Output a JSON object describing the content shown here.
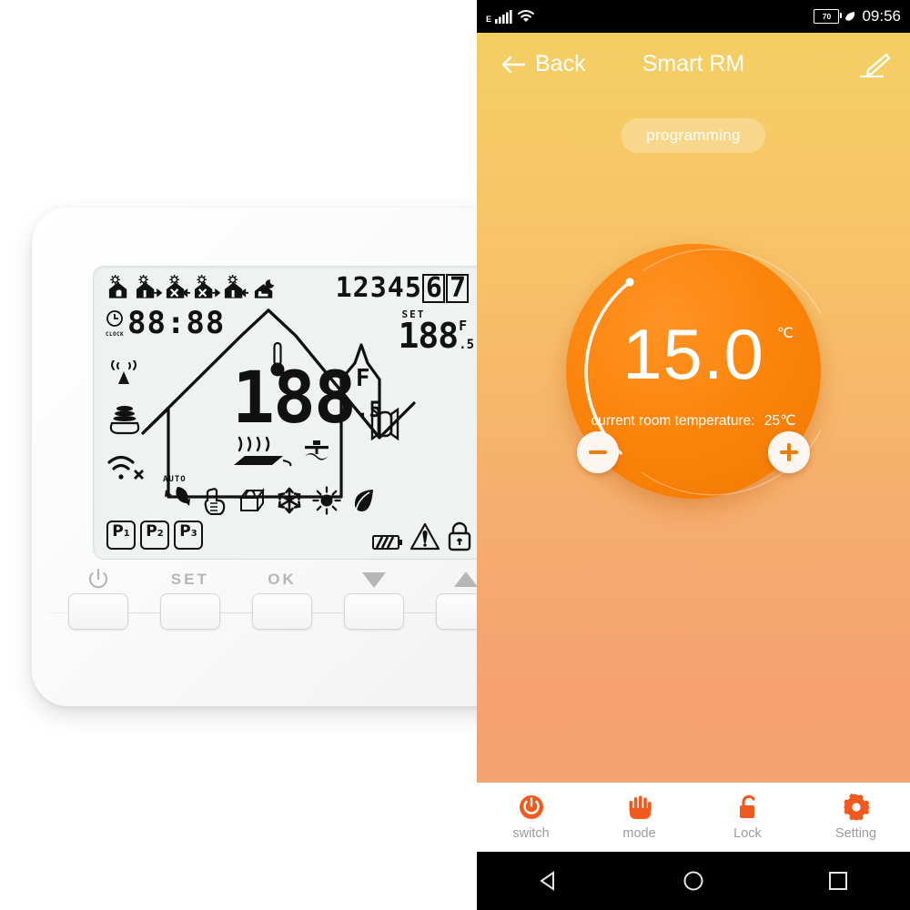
{
  "left_panel": {
    "device_name": "programmable-room-thermostat",
    "lcd": {
      "scene_icons": [
        "wake-home-icon",
        "leave-home-icon",
        "return-home-icon",
        "leave-home-2-icon",
        "return-home-2-icon",
        "sleep-home-icon"
      ],
      "day_numbers": [
        "1",
        "2",
        "3",
        "4",
        "5",
        "6",
        "7"
      ],
      "day_boxed": [
        "6",
        "7"
      ],
      "clock_label": "CLOCK",
      "clock_value": "88:88",
      "left_icons": [
        "rf-antenna-icon",
        "cloud-server-icon",
        "wifi-disconnected-icon"
      ],
      "main_temp": "188",
      "main_temp_unit": "F",
      "main_temp_half": ".5",
      "set_label": "SET",
      "set_temp": "188",
      "set_temp_unit": "F",
      "set_temp_half": ".5",
      "auto_label": "AUTO",
      "mode_icons": [
        "auto-cycle-icon",
        "manual-hand-icon",
        "holiday-bag-icon",
        "snowflake-icon",
        "sun-icon",
        "eco-leaf-icon"
      ],
      "program_badges": [
        "P1",
        "P2",
        "P3"
      ],
      "status_icons": [
        "battery-icon",
        "warning-triangle-icon",
        "lock-icon"
      ],
      "indoor_icons": [
        "thermometer-icon",
        "floor-heating-icon",
        "fan-icon",
        "window-icon"
      ]
    },
    "buttons": [
      {
        "label": "",
        "icon": "power-icon",
        "name": "power-button"
      },
      {
        "label": "SET",
        "icon": "",
        "name": "set-button"
      },
      {
        "label": "OK",
        "icon": "ok-icon",
        "name": "ok-button"
      },
      {
        "label": "",
        "icon": "arrow-down-icon",
        "name": "down-button"
      },
      {
        "label": "",
        "icon": "arrow-up-icon",
        "name": "up-button"
      }
    ]
  },
  "phone": {
    "status_bar": {
      "network_type": "E",
      "signal_icon": "cellular-signal-icon",
      "wifi_icon": "wifi-icon",
      "battery_level": "70",
      "sync_icon": "sync-icon",
      "time": "09:56"
    },
    "app_bar": {
      "back_label": "Back",
      "back_icon": "arrow-left-icon",
      "title": "Smart RM",
      "edit_icon": "edit-pencil-icon"
    },
    "programming_button": "programming",
    "dial": {
      "set_temperature": "15.0",
      "unit": "℃",
      "current_label": "current room temperature:",
      "current_value": "25℃",
      "minus_icon": "minus-icon",
      "plus_icon": "plus-icon",
      "arc_percent": 0.58,
      "color": "#f9830a"
    },
    "tabs": [
      {
        "label": "switch",
        "icon": "power-icon"
      },
      {
        "label": "mode",
        "icon": "hand-icon"
      },
      {
        "label": "Lock",
        "icon": "unlock-icon"
      },
      {
        "label": "Setting",
        "icon": "gear-icon"
      }
    ],
    "nav_bar": {
      "back": "nav-back-triangle-icon",
      "home": "nav-home-circle-icon",
      "recents": "nav-recents-square-icon"
    },
    "accent_color": "#f05a1e",
    "tab_label_color": "#9b9b9b"
  }
}
